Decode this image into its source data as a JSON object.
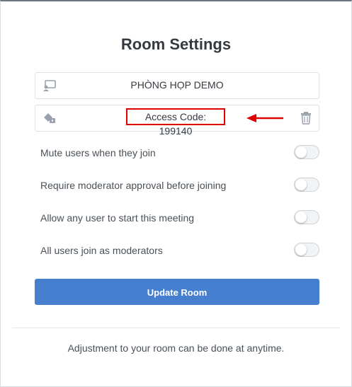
{
  "modal": {
    "title": "Room Settings",
    "room_name": "PHÒNG HỌP DEMO",
    "access_code": "Access Code: 199140",
    "settings": [
      {
        "label": "Mute users when they join",
        "enabled": false
      },
      {
        "label": "Require moderator approval before joining",
        "enabled": false
      },
      {
        "label": "Allow any user to start this meeting",
        "enabled": false
      },
      {
        "label": "All users join as moderators",
        "enabled": false
      }
    ],
    "update_button": "Update Room",
    "footer_note": "Adjustment to your room can be done at anytime."
  },
  "colors": {
    "accent": "#467fcf",
    "highlight": "#e00000"
  },
  "icons": [
    "room-icon",
    "key-icon",
    "arrow-icon",
    "trash-icon"
  ]
}
